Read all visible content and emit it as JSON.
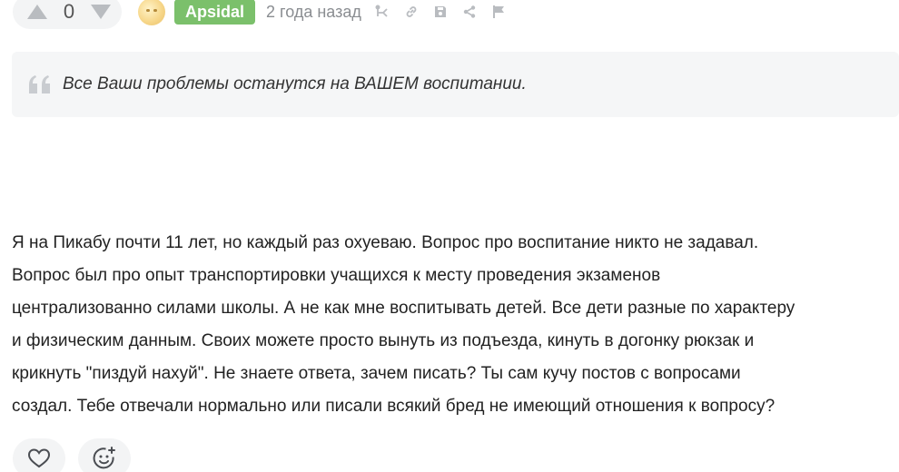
{
  "comment": {
    "rating": "0",
    "author": "Apsidal",
    "time": "2 года назад",
    "quote": "Все Ваши проблемы останутся на ВАШЕМ воспитании.",
    "body_lines": [
      "Я на Пикабу почти 11 лет, но каждый раз охуеваю. Вопрос про воспитание никто не задавал.",
      "Вопрос был про опыт транспортировки учащихся к месту проведения экзаменов",
      "централизованно силами школы. А не как мне воспитывать детей. Все дети разные по характеру",
      "и физическим данным. Своих можете просто вынуть из подъезда, кинуть в догонку рюкзак и",
      "крикнуть \"пиздуй нахуй\". Не знаете ответа, зачем писать? Ты сам кучу постов с вопросами",
      "создал. Тебе отвечали нормально или писали всякий бред не имеющий отношения к вопросу?"
    ]
  },
  "colors": {
    "author_badge": "#7bc06b",
    "icon_gray": "#b9bcc0",
    "panel_bg": "#f3f4f5"
  },
  "icons": {
    "upvote": "triangle-up-icon",
    "downvote": "triangle-down-icon",
    "branch": "branch-icon",
    "link": "link-icon",
    "save": "save-icon",
    "share": "share-icon",
    "report": "flag-icon",
    "quote": "quote-icon",
    "like": "heart-icon",
    "emoji": "emoji-add-icon"
  }
}
